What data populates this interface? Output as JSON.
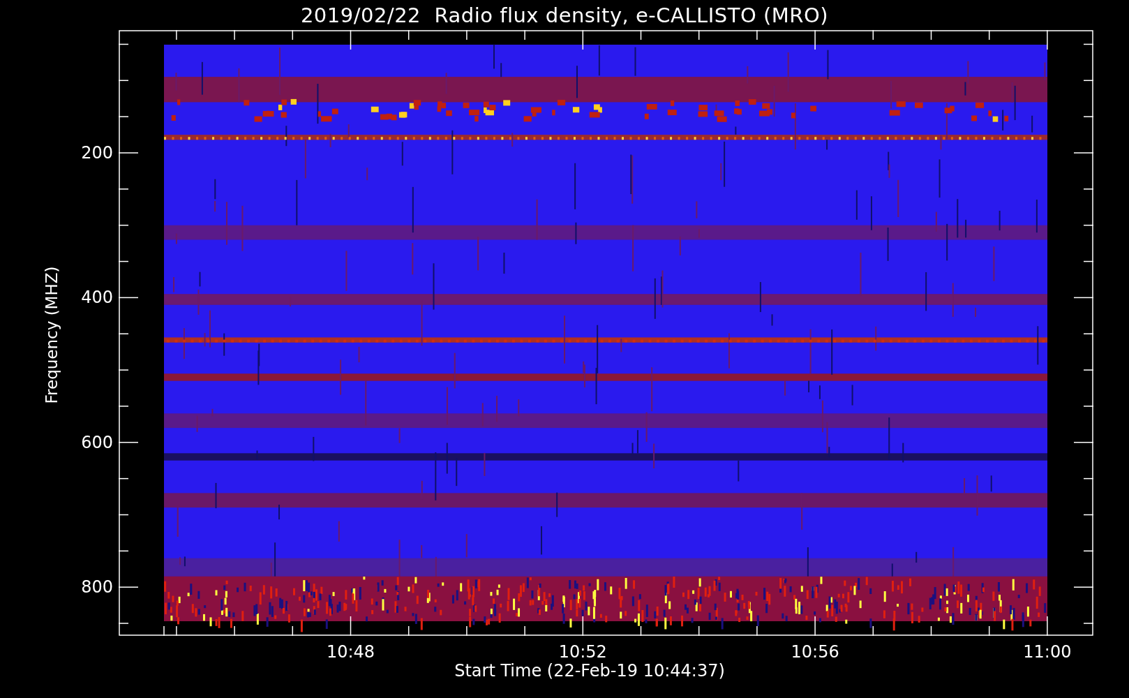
{
  "title": "2019/02/22  Radio flux density, e-CALLISTO (MRO)",
  "y_axis": {
    "label": "Frequency (MHZ)",
    "ticks": [
      "200",
      "400",
      "600",
      "800"
    ]
  },
  "x_axis": {
    "label": "Start Time (22-Feb-19 10:44:37)",
    "ticks": [
      "10:48",
      "10:52",
      "10:56",
      "11:00"
    ]
  }
}
